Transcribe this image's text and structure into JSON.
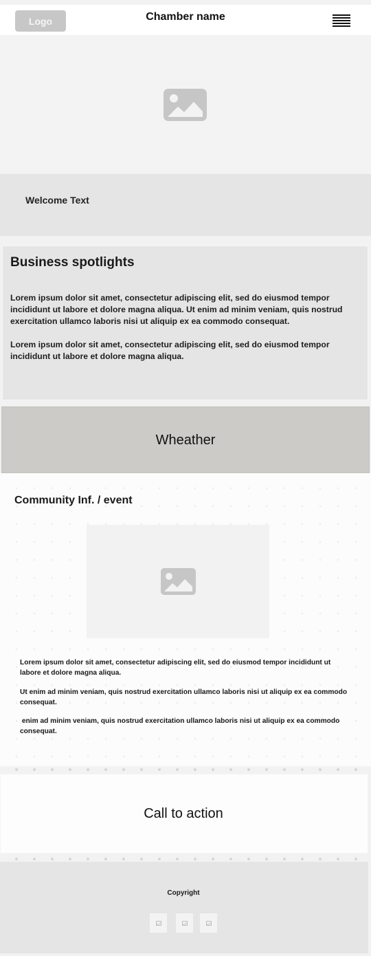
{
  "header": {
    "logo": "Logo",
    "title": "Chamber name",
    "menu_icon": "hamburger-menu-icon"
  },
  "hero": {
    "icon": "image-placeholder-icon"
  },
  "welcome": {
    "text": "Welcome Text"
  },
  "spotlights": {
    "title": "Business spotlights",
    "paragraphs": [
      "Lorem ipsum dolor sit amet, consectetur adipiscing elit, sed do eiusmod tempor incididunt ut labore et dolore magna aliqua. Ut enim ad minim veniam, quis nostrud exercitation ullamco laboris nisi ut aliquip ex ea commodo consequat.",
      "Lorem ipsum dolor sit amet, consectetur adipiscing elit, sed do eiusmod tempor incididunt ut labore et dolore magna aliqua."
    ]
  },
  "weather": {
    "label": "Wheather"
  },
  "community": {
    "title": "Community Inf. / event",
    "image_icon": "image-placeholder-icon",
    "paragraphs": [
      "Lorem ipsum dolor sit amet, consectetur adipiscing elit, sed do eiusmod tempor incididunt ut labore et dolore magna aliqua.",
      "Ut enim ad minim veniam, quis nostrud exercitation ullamco laboris nisi ut aliquip ex ea commodo consequat.",
      " enim ad minim veniam, quis nostrud exercitation ullamco laboris nisi ut aliquip ex ea commodo consequat."
    ]
  },
  "cta": {
    "label": "Call to action"
  },
  "footer": {
    "copyright": "Copyright",
    "social_icons": [
      "social-icon-1",
      "social-icon-2",
      "social-icon-3"
    ]
  },
  "colors": {
    "header_bg": "#ffffff",
    "logo_bg": "#c7c7c7",
    "section_gray": "#e5e5e5",
    "weather_bg": "#cdcbc7",
    "placeholder_icon": "#c6c6c6"
  }
}
